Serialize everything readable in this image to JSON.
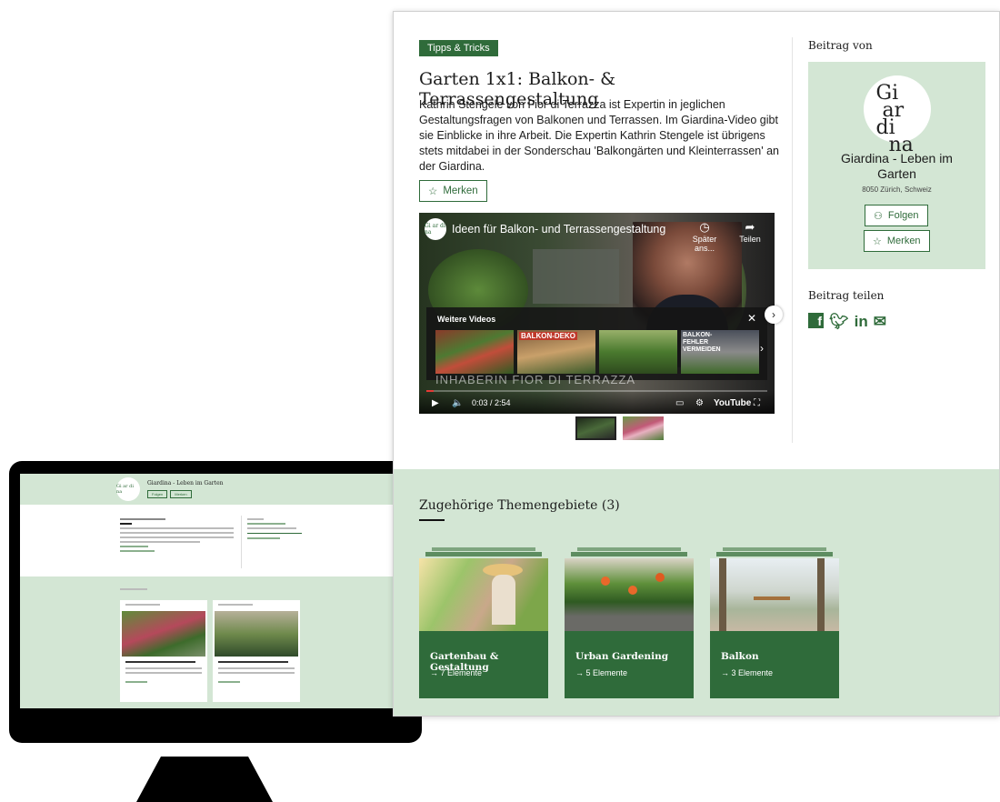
{
  "article": {
    "tag": "Tipps & Tricks",
    "title": "Garten 1x1: Balkon- & Terrassengestaltung",
    "intro": "Kathrin Stengele von Fior di Terrazza ist Expertin in jeglichen Gestaltungsfragen von Balkonen und Terrassen. Im Giardina-Video gibt sie Einblicke in ihre Arbeit. Die Expertin Kathrin Stengele ist übrigens stets mitdabei in der Sonderschau 'Balkongärten und Kleinterrassen' an der Giardina.",
    "bookmark_label": "Merken"
  },
  "video": {
    "title": "Ideen für Balkon- und Terrassengestaltung",
    "watch_later": "Später ans...",
    "share": "Teilen",
    "more_videos": "Weitere Videos",
    "thumb_labels": [
      "",
      "BALKON-DEKO",
      "",
      "BALKON-FEHLER VERMEIDEN"
    ],
    "caption": "INHABERIN FIOR DI TERRAZZA",
    "time": "0:03 / 2:54",
    "brand": "YouTube"
  },
  "sidebar": {
    "contributed_by": "Beitrag von",
    "logo_text": "Giardina",
    "author_name": "Giardina - Leben im Garten",
    "location": "8050 Zürich, Schweiz",
    "follow_label": "Folgen",
    "bookmark_label": "Merken",
    "share_heading": "Beitrag teilen"
  },
  "related": {
    "heading": "Zugehörige Themengebiete (3)",
    "topics": [
      {
        "name": "Gartenbau & Gestaltung",
        "count": "→  7 Elemente"
      },
      {
        "name": "Urban Gardening",
        "count": "→  5 Elemente"
      },
      {
        "name": "Balkon",
        "count": "→  3 Elemente"
      }
    ]
  },
  "monitor": {
    "author_name": "Giardina - Leben im Garten",
    "follow_label": "Folgen",
    "bookmark_label": "Merken"
  },
  "colors": {
    "accent": "#2f6b3a",
    "pale_green": "#d3e6d4"
  }
}
